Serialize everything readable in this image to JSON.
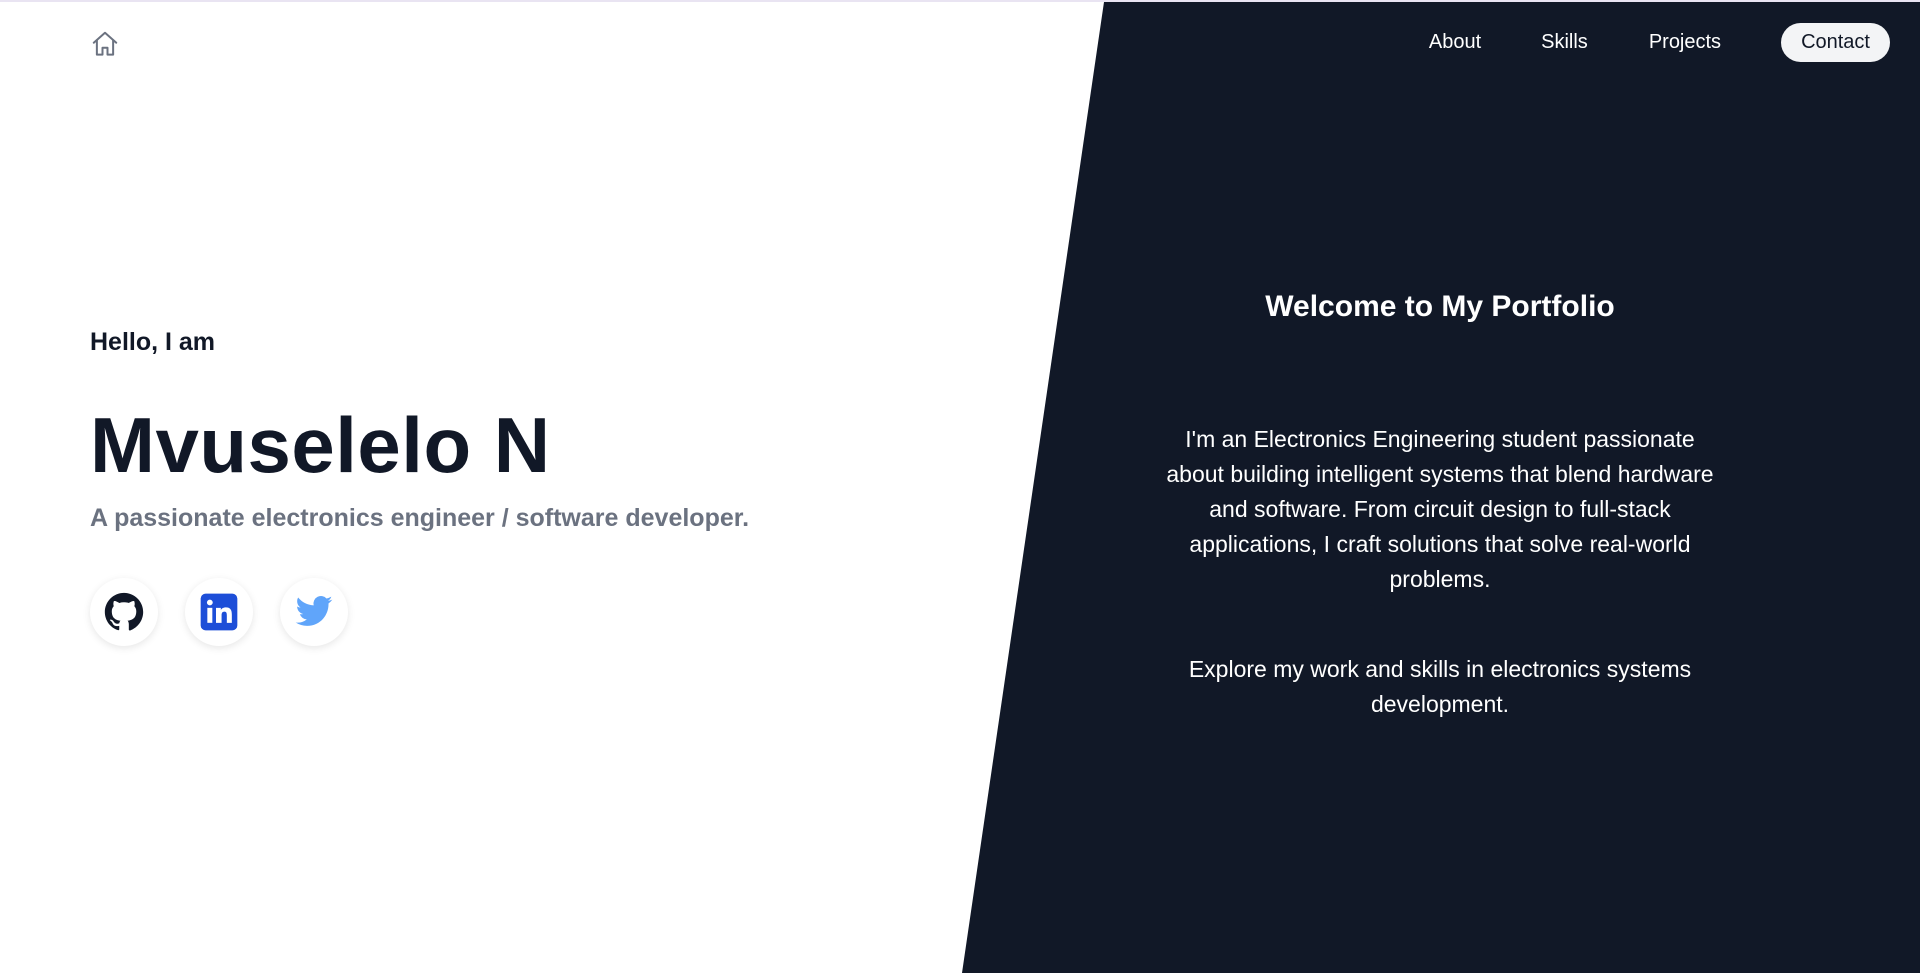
{
  "header": {
    "home_icon": "home-icon",
    "nav": {
      "about": "About",
      "skills": "Skills",
      "projects": "Projects",
      "contact": "Contact"
    }
  },
  "hero": {
    "greeting": "Hello, I am",
    "name": "Mvuselelo N",
    "tagline": "A passionate electronics engineer / software developer.",
    "socials": [
      {
        "icon": "github-icon",
        "color": "#111827"
      },
      {
        "icon": "linkedin-icon",
        "color": "#1d4ed8"
      },
      {
        "icon": "twitter-icon",
        "color": "#60a5fa"
      }
    ]
  },
  "welcome": {
    "title": "Welcome to My Portfolio",
    "body": "I'm an Electronics Engineering student passionate about building intelligent systems that blend hardware and software. From circuit design to full-stack applications, I craft solutions that solve real-world problems.",
    "explore": "Explore my work and skills in electronics systems development."
  },
  "colors": {
    "dark_panel": "#111827",
    "text_primary": "#111827",
    "text_muted": "#6b7280",
    "white": "#ffffff"
  }
}
